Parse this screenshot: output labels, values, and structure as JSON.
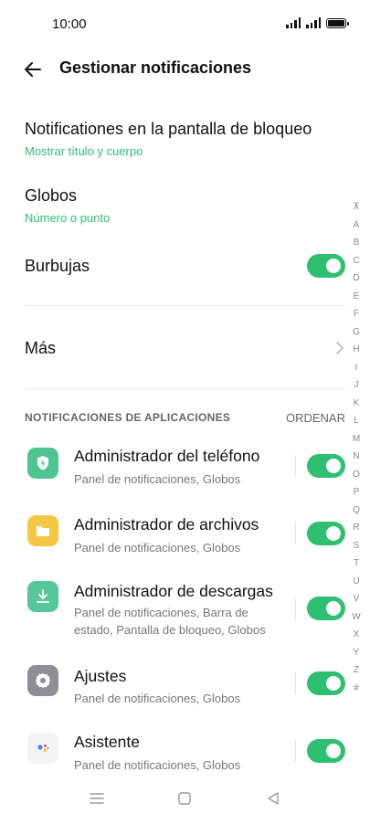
{
  "status_bar": {
    "time": "10:00"
  },
  "header": {
    "title": "Gestionar notificaciones"
  },
  "settings": {
    "lock_screen": {
      "title": "Notificationes en la pantalla de bloqueo",
      "subtitle": "Mostrar título y cuerpo"
    },
    "globos": {
      "title": "Globos",
      "subtitle": "Número o punto"
    },
    "burbujas": {
      "title": "Burbujas",
      "enabled": true
    },
    "mas": {
      "title": "Más"
    }
  },
  "apps_section": {
    "header": "NOTIFICACIONES DE APLICACIONES",
    "order_label": "ORDENAR"
  },
  "apps": [
    {
      "name": "Administrador del teléfono",
      "subtitle": "Panel de notificaciones, Globos",
      "icon": "shield-icon",
      "color": "#4ec48f",
      "enabled": true
    },
    {
      "name": "Administrador de archivos",
      "subtitle": "Panel de notificaciones, Globos",
      "icon": "folder-icon",
      "color": "#f4c842",
      "enabled": true
    },
    {
      "name": "Administrador de descargas",
      "subtitle": "Panel de notificaciones, Barra de estado, Pantalla de bloqueo, Globos",
      "icon": "download-icon",
      "color": "#55c79a",
      "enabled": true
    },
    {
      "name": "Ajustes",
      "subtitle": "Panel de notificaciones, Globos",
      "icon": "gear-icon",
      "color": "#8e8e97",
      "enabled": true
    },
    {
      "name": "Asistente",
      "subtitle": "Panel de notificaciones, Globos",
      "icon": "assistant-icon",
      "color": "#f4f4f4",
      "enabled": true
    }
  ],
  "alpha_index": [
    "⊼",
    "A",
    "B",
    "C",
    "D",
    "E",
    "F",
    "G",
    "H",
    "I",
    "J",
    "K",
    "L",
    "M",
    "N",
    "O",
    "P",
    "Q",
    "R",
    "S",
    "T",
    "U",
    "V",
    "W",
    "X",
    "Y",
    "Z",
    "#"
  ],
  "colors": {
    "accent": "#2fbf71",
    "toggle_on": "#2fbf71"
  }
}
